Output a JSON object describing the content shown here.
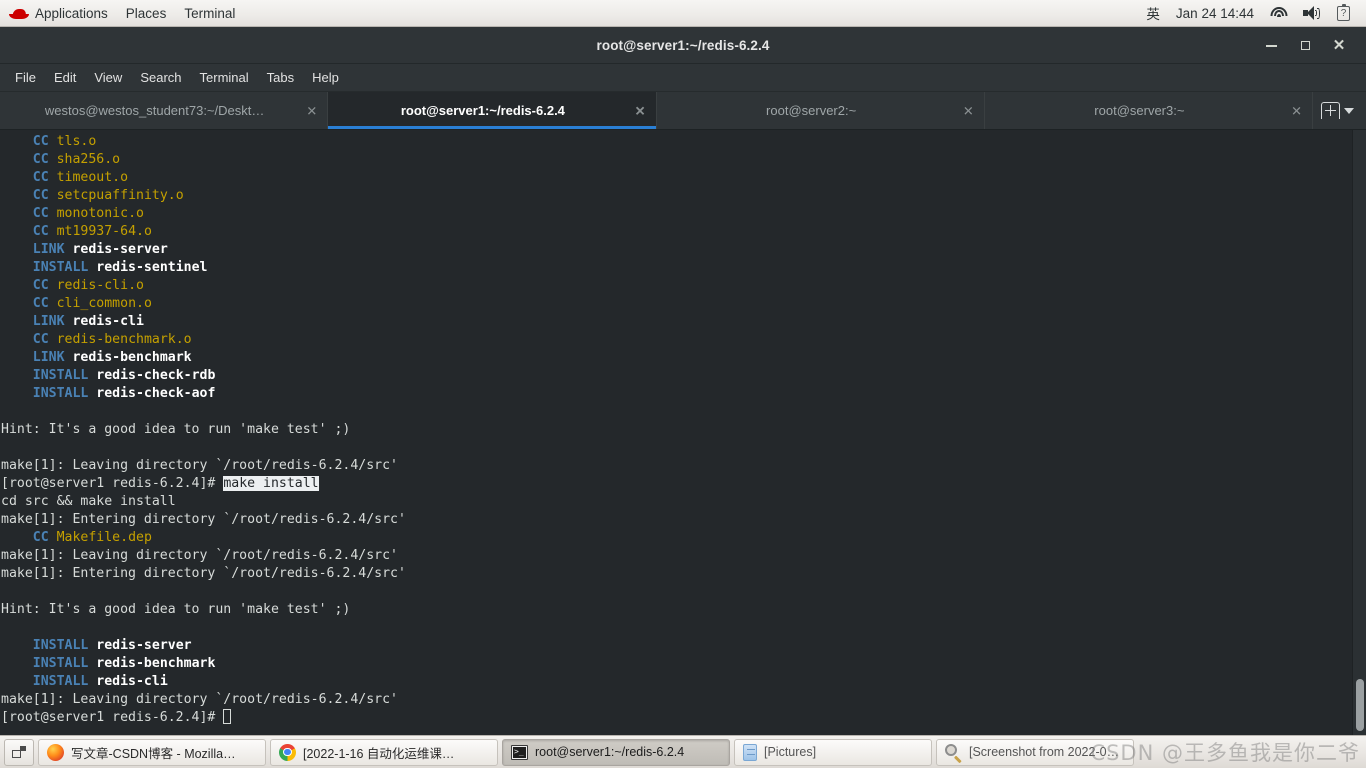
{
  "panel": {
    "logo_icon": "redhat-logo-icon",
    "menus": [
      "Applications",
      "Places",
      "Terminal"
    ],
    "tray": {
      "input_method": "英",
      "clock": "Jan 24  14:44",
      "wifi_icon": "wifi-icon",
      "volume_icon": "volume-icon",
      "battery_icon": "battery-unknown-icon"
    }
  },
  "window": {
    "title": "root@server1:~/redis-6.2.4",
    "controls": {
      "minimize": "_",
      "maximize": "□",
      "close": "✕"
    }
  },
  "menubar": [
    "File",
    "Edit",
    "View",
    "Search",
    "Terminal",
    "Tabs",
    "Help"
  ],
  "tabs": [
    {
      "label": "westos@westos_student73:~/Deskt…",
      "active": false,
      "close": "✕"
    },
    {
      "label": "root@server1:~/redis-6.2.4",
      "active": true,
      "close": "✕"
    },
    {
      "label": "root@server2:~",
      "active": false,
      "close": "✕"
    },
    {
      "label": "root@server3:~",
      "active": false,
      "close": "✕"
    }
  ],
  "tab_tools": {
    "new_tab_icon": "new-tab-icon",
    "tab_list_icon": "chevron-down-icon"
  },
  "terminal": {
    "lines": [
      [
        {
          "t": "    ",
          "c": "plain"
        },
        {
          "t": "CC",
          "c": "key"
        },
        {
          "t": " ",
          "c": "plain"
        },
        {
          "t": "tls.o",
          "c": "file"
        }
      ],
      [
        {
          "t": "    ",
          "c": "plain"
        },
        {
          "t": "CC",
          "c": "key"
        },
        {
          "t": " ",
          "c": "plain"
        },
        {
          "t": "sha256.o",
          "c": "file"
        }
      ],
      [
        {
          "t": "    ",
          "c": "plain"
        },
        {
          "t": "CC",
          "c": "key"
        },
        {
          "t": " ",
          "c": "plain"
        },
        {
          "t": "timeout.o",
          "c": "file"
        }
      ],
      [
        {
          "t": "    ",
          "c": "plain"
        },
        {
          "t": "CC",
          "c": "key"
        },
        {
          "t": " ",
          "c": "plain"
        },
        {
          "t": "setcpuaffinity.o",
          "c": "file"
        }
      ],
      [
        {
          "t": "    ",
          "c": "plain"
        },
        {
          "t": "CC",
          "c": "key"
        },
        {
          "t": " ",
          "c": "plain"
        },
        {
          "t": "monotonic.o",
          "c": "file"
        }
      ],
      [
        {
          "t": "    ",
          "c": "plain"
        },
        {
          "t": "CC",
          "c": "key"
        },
        {
          "t": " ",
          "c": "plain"
        },
        {
          "t": "mt19937-64.o",
          "c": "file"
        }
      ],
      [
        {
          "t": "    ",
          "c": "plain"
        },
        {
          "t": "LINK",
          "c": "key"
        },
        {
          "t": " ",
          "c": "plain"
        },
        {
          "t": "redis-server",
          "c": "tgt"
        }
      ],
      [
        {
          "t": "    ",
          "c": "plain"
        },
        {
          "t": "INSTALL",
          "c": "key"
        },
        {
          "t": " ",
          "c": "plain"
        },
        {
          "t": "redis-sentinel",
          "c": "tgt"
        }
      ],
      [
        {
          "t": "    ",
          "c": "plain"
        },
        {
          "t": "CC",
          "c": "key"
        },
        {
          "t": " ",
          "c": "plain"
        },
        {
          "t": "redis-cli.o",
          "c": "file"
        }
      ],
      [
        {
          "t": "    ",
          "c": "plain"
        },
        {
          "t": "CC",
          "c": "key"
        },
        {
          "t": " ",
          "c": "plain"
        },
        {
          "t": "cli_common.o",
          "c": "file"
        }
      ],
      [
        {
          "t": "    ",
          "c": "plain"
        },
        {
          "t": "LINK",
          "c": "key"
        },
        {
          "t": " ",
          "c": "plain"
        },
        {
          "t": "redis-cli",
          "c": "tgt"
        }
      ],
      [
        {
          "t": "    ",
          "c": "plain"
        },
        {
          "t": "CC",
          "c": "key"
        },
        {
          "t": " ",
          "c": "plain"
        },
        {
          "t": "redis-benchmark.o",
          "c": "file"
        }
      ],
      [
        {
          "t": "    ",
          "c": "plain"
        },
        {
          "t": "LINK",
          "c": "key"
        },
        {
          "t": " ",
          "c": "plain"
        },
        {
          "t": "redis-benchmark",
          "c": "tgt"
        }
      ],
      [
        {
          "t": "    ",
          "c": "plain"
        },
        {
          "t": "INSTALL",
          "c": "key"
        },
        {
          "t": " ",
          "c": "plain"
        },
        {
          "t": "redis-check-rdb",
          "c": "tgt"
        }
      ],
      [
        {
          "t": "    ",
          "c": "plain"
        },
        {
          "t": "INSTALL",
          "c": "key"
        },
        {
          "t": " ",
          "c": "plain"
        },
        {
          "t": "redis-check-aof",
          "c": "tgt"
        }
      ],
      [],
      [
        {
          "t": "Hint: It's a good idea to run 'make test' ;)",
          "c": "plain"
        }
      ],
      [],
      [
        {
          "t": "make[1]: Leaving directory `/root/redis-6.2.4/src'",
          "c": "plain"
        }
      ],
      [
        {
          "t": "[root@server1 redis-6.2.4]# ",
          "c": "plain"
        },
        {
          "t": "make install",
          "c": "sel"
        }
      ],
      [
        {
          "t": "cd src && make install",
          "c": "plain"
        }
      ],
      [
        {
          "t": "make[1]: Entering directory `/root/redis-6.2.4/src'",
          "c": "plain"
        }
      ],
      [
        {
          "t": "    ",
          "c": "plain"
        },
        {
          "t": "CC",
          "c": "key"
        },
        {
          "t": " ",
          "c": "plain"
        },
        {
          "t": "Makefile.dep",
          "c": "file"
        }
      ],
      [
        {
          "t": "make[1]: Leaving directory `/root/redis-6.2.4/src'",
          "c": "plain"
        }
      ],
      [
        {
          "t": "make[1]: Entering directory `/root/redis-6.2.4/src'",
          "c": "plain"
        }
      ],
      [],
      [
        {
          "t": "Hint: It's a good idea to run 'make test' ;)",
          "c": "plain"
        }
      ],
      [],
      [
        {
          "t": "    ",
          "c": "plain"
        },
        {
          "t": "INSTALL",
          "c": "key"
        },
        {
          "t": " ",
          "c": "plain"
        },
        {
          "t": "redis-server",
          "c": "tgt"
        }
      ],
      [
        {
          "t": "    ",
          "c": "plain"
        },
        {
          "t": "INSTALL",
          "c": "key"
        },
        {
          "t": " ",
          "c": "plain"
        },
        {
          "t": "redis-benchmark",
          "c": "tgt"
        }
      ],
      [
        {
          "t": "    ",
          "c": "plain"
        },
        {
          "t": "INSTALL",
          "c": "key"
        },
        {
          "t": " ",
          "c": "plain"
        },
        {
          "t": "redis-cli",
          "c": "tgt"
        }
      ],
      [
        {
          "t": "make[1]: Leaving directory `/root/redis-6.2.4/src'",
          "c": "plain"
        }
      ],
      [
        {
          "t": "[root@server1 redis-6.2.4]# ",
          "c": "plain"
        },
        {
          "t": "",
          "c": "cursor"
        }
      ]
    ]
  },
  "taskbar": {
    "show_desktop_icon": "window-list-icon",
    "items": [
      {
        "label": "写文章-CSDN博客 - Mozilla…",
        "icon": "firefox-icon",
        "active": false
      },
      {
        "label": "[2022-1-16 自动化运维课…",
        "icon": "chrome-icon",
        "active": false
      },
      {
        "label": "root@server1:~/redis-6.2.4",
        "icon": "terminal-icon",
        "active": true
      },
      {
        "label": "[Pictures]",
        "icon": "files-icon",
        "active": false
      },
      {
        "label": "[Screenshot from 2022-01…",
        "icon": "screenshot-icon",
        "active": false
      }
    ]
  },
  "watermark": {
    "text": "CSDN @王多鱼我是你二爷"
  },
  "colors": {
    "accent_tab_underline": "#2a7fd4",
    "terminal_bg": "#24282b",
    "terminal_fg": "#d7dbd9",
    "make_keyword": "#4a82b5",
    "object_file": "#c4a000",
    "selection_bg": "#eceff1"
  }
}
